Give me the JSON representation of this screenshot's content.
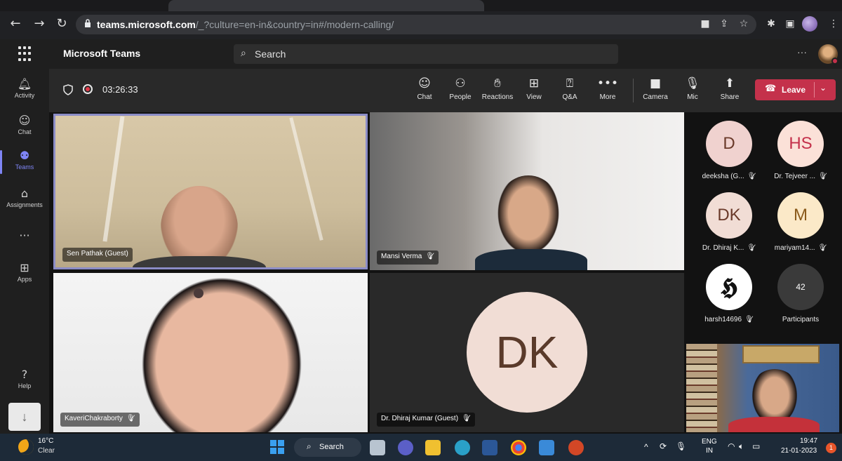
{
  "browser": {
    "url_host": "teams.microsoft.com",
    "url_path": "/_?culture=en-in&country=in#/modern-calling/"
  },
  "teams_header": {
    "app_title": "Microsoft Teams",
    "search_placeholder": "Search",
    "more": "···"
  },
  "rail": {
    "items": [
      {
        "label": "Activity",
        "icon": "bell-icon"
      },
      {
        "label": "Chat",
        "icon": "chat-icon"
      },
      {
        "label": "Teams",
        "icon": "teams-icon"
      },
      {
        "label": "Assignments",
        "icon": "backpack-icon"
      },
      {
        "label": "Apps",
        "icon": "apps-icon"
      },
      {
        "label": "Help",
        "icon": "help-icon"
      }
    ],
    "more": "···"
  },
  "call_bar": {
    "timer": "03:26:33",
    "buttons": [
      {
        "label": "Chat",
        "icon": "chat-icon"
      },
      {
        "label": "People",
        "icon": "people-icon"
      },
      {
        "label": "Reactions",
        "icon": "reactions-icon"
      },
      {
        "label": "View",
        "icon": "view-icon"
      },
      {
        "label": "Q&A",
        "icon": "qa-icon"
      },
      {
        "label": "More",
        "icon": "more-icon"
      },
      {
        "label": "Camera",
        "icon": "camera-icon"
      },
      {
        "label": "Mic",
        "icon": "mic-icon"
      },
      {
        "label": "Share",
        "icon": "share-icon"
      }
    ],
    "leave_label": "Leave",
    "leave_color": "#c4314b"
  },
  "video_tiles": [
    {
      "name": "Sen Pathak (Guest)",
      "muted": false
    },
    {
      "name": "Mansi Verma",
      "muted": true
    },
    {
      "name": "KaveriChakraborty",
      "muted": true
    },
    {
      "name": "Dr. Dhiraj Kumar (Guest)",
      "muted": true,
      "initials": "DK"
    }
  ],
  "roster": [
    {
      "initials": "D",
      "name": "deeksha (G...",
      "color": "#f0d2cf"
    },
    {
      "initials": "HS",
      "name": "Dr. Tejveer ...",
      "color": "#fbe1d8"
    },
    {
      "initials": "DK",
      "name": "Dr. Dhiraj K...",
      "color": "#f1ddd5"
    },
    {
      "initials": "M",
      "name": "mariyam14...",
      "color": "#fbe9c8"
    },
    {
      "initials": "𝕳",
      "name": "harsh14696",
      "color": "#ffffff"
    },
    {
      "initials": "42",
      "name": "Participants",
      "color": "#3a3a3a"
    }
  ],
  "taskbar": {
    "temp": "16°C",
    "condition": "Clear",
    "search_label": "Search",
    "lang_line1": "ENG",
    "lang_line2": "IN",
    "time": "19:47",
    "date": "21-01-2023",
    "notification_count": "1"
  }
}
